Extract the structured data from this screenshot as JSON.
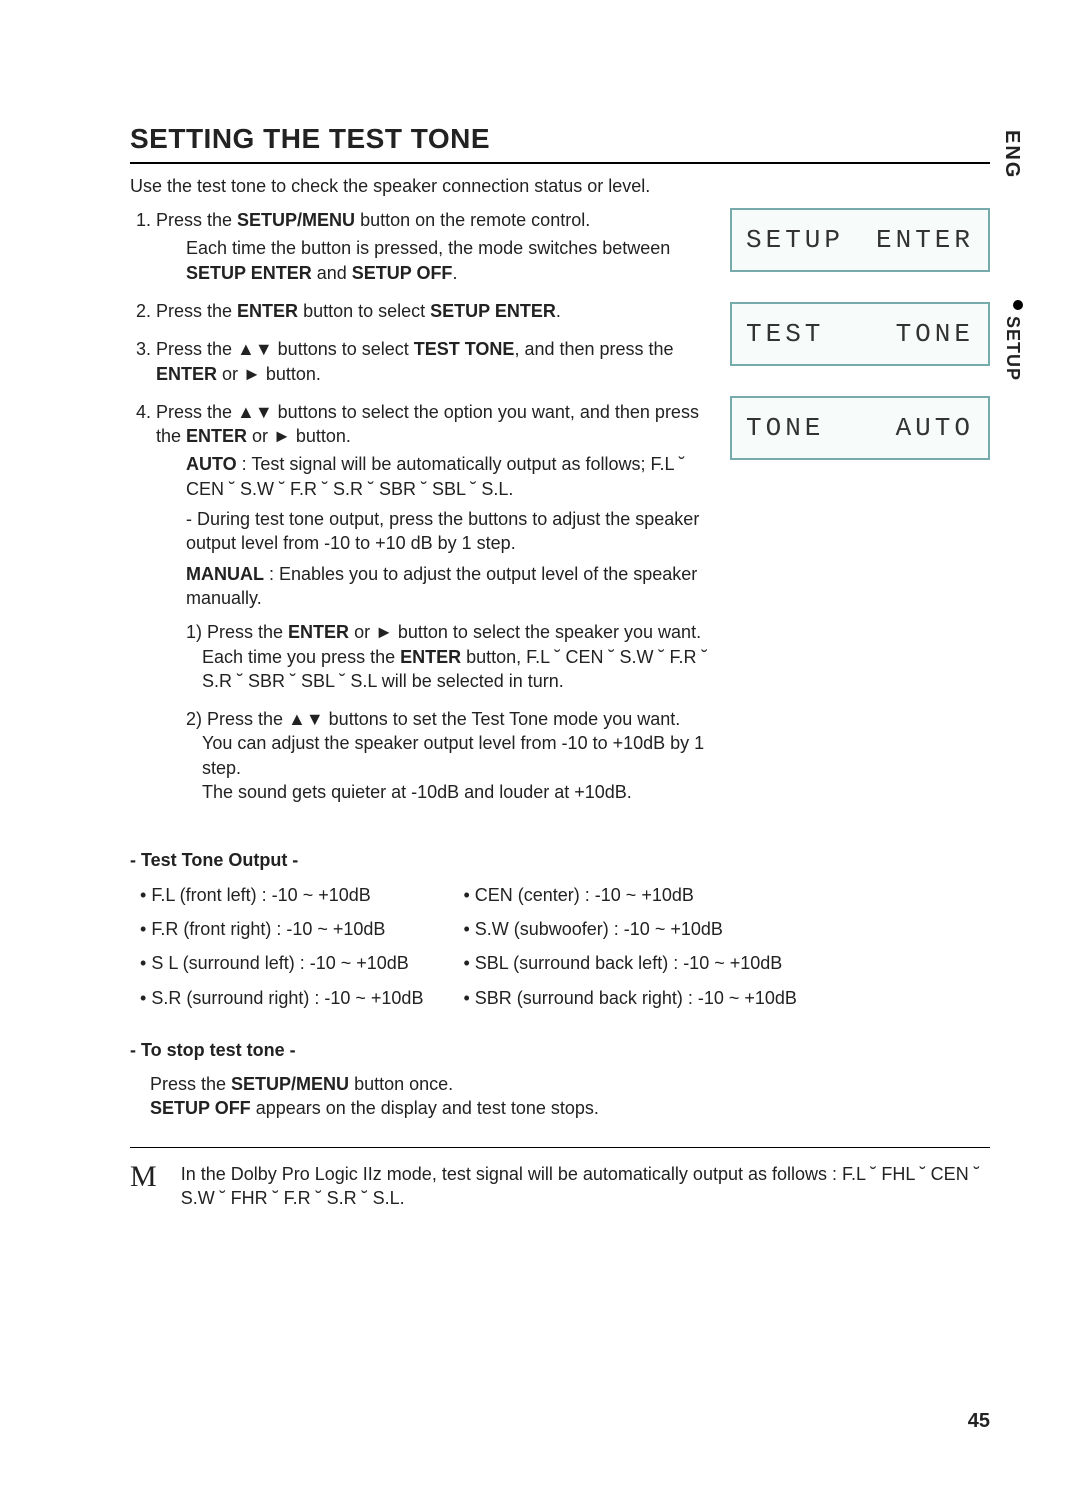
{
  "sideLang": "ENG",
  "sideTab": "SETUP",
  "title": "SETTING THE TEST TONE",
  "intro": "Use the test tone to check the speaker connection status or level.",
  "steps": {
    "s1_a": "Press the ",
    "s1_btn": "SETUP/MENU",
    "s1_b": " button on the remote control.",
    "s1_sub_a": "Each time the button is pressed, the mode switches between ",
    "s1_sub_b": "SETUP ENTER",
    "s1_sub_c": " and ",
    "s1_sub_d": "SETUP OFF",
    "s1_sub_e": ".",
    "s2_a": "Press the ",
    "s2_b": "ENTER",
    "s2_c": " button to select ",
    "s2_d": "SETUP ENTER",
    "s2_e": ".",
    "s3_a": "Press the ▲▼ buttons to select ",
    "s3_b": "TEST TONE",
    "s3_c": ", and then press the ",
    "s3_d": "ENTER",
    "s3_e": " or ► button.",
    "s4_a": "Press the ▲▼ buttons to select the option you want, and then press the ",
    "s4_b": "ENTER",
    "s4_c": " or ► button.",
    "s4_auto_lbl": "AUTO",
    "s4_auto_a": " : Test signal will be automatically output as follows;  F.L  ˘  CEN  ˘ S.W  ˘  F.R  ˘  S.R  ˘  SBR  ˘  SBL  ˘  S.L.",
    "s4_auto_b": "- During test tone output, press the          buttons to adjust the speaker output level from -10 to +10 dB by 1 step.",
    "s4_man_lbl": "MANUAL",
    "s4_man_a": " : Enables you to adjust the output level of the speaker manually.",
    "s4_m1_a": "1) Press the ",
    "s4_m1_b": "ENTER",
    "s4_m1_c": " or ► button to select the speaker you want.",
    "s4_m1_d": "Each time you press the ",
    "s4_m1_e": "ENTER",
    "s4_m1_f": " button, F.L  ˘  CEN  ˘  S.W  ˘  F.R  ˘  S.R  ˘  SBR  ˘  SBL ˘  S.L will be selected in turn.",
    "s4_m2_a": "2) Press the ▲▼ buttons to set the Test Tone mode you want.",
    "s4_m2_b": "You can adjust the speaker output level from -10 to +10dB by 1 step.",
    "s4_m2_c": "The sound gets quieter at -10dB and louder at +10dB."
  },
  "displays": [
    {
      "left": "SETUP",
      "right": "ENTER"
    },
    {
      "left": "TEST",
      "right": "TONE"
    },
    {
      "left": "TONE",
      "right": "AUTO"
    }
  ],
  "toneOutput": {
    "heading": "- Test Tone Output -",
    "colA": [
      "F.L (front left) : -10 ~ +10dB",
      "F.R (front right) : -10 ~ +10dB",
      "S L (surround left) : -10 ~ +10dB",
      "S.R (surround right) : -10 ~ +10dB"
    ],
    "colB": [
      "CEN (center) : -10 ~ +10dB",
      "S.W (subwoofer) : -10 ~ +10dB",
      "SBL (surround back left) : -10 ~ +10dB",
      "SBR (surround back right) : -10 ~ +10dB"
    ]
  },
  "stop": {
    "heading": "- To stop test tone -",
    "line1_a": "Press the ",
    "line1_b": "SETUP/MENU",
    "line1_c": " button once.",
    "line2_a": "SETUP OFF",
    "line2_b": " appears on the display and test tone stops."
  },
  "noteIcon": "M",
  "note": "In the Dolby Pro Logic IIz mode, test signal will be automatically output as follows :  F.L  ˘  FHL  ˘  CEN  ˘ S.W  ˘  FHR  ˘  F.R  ˘  S.R  ˘  S.L.",
  "pageNum": "45"
}
